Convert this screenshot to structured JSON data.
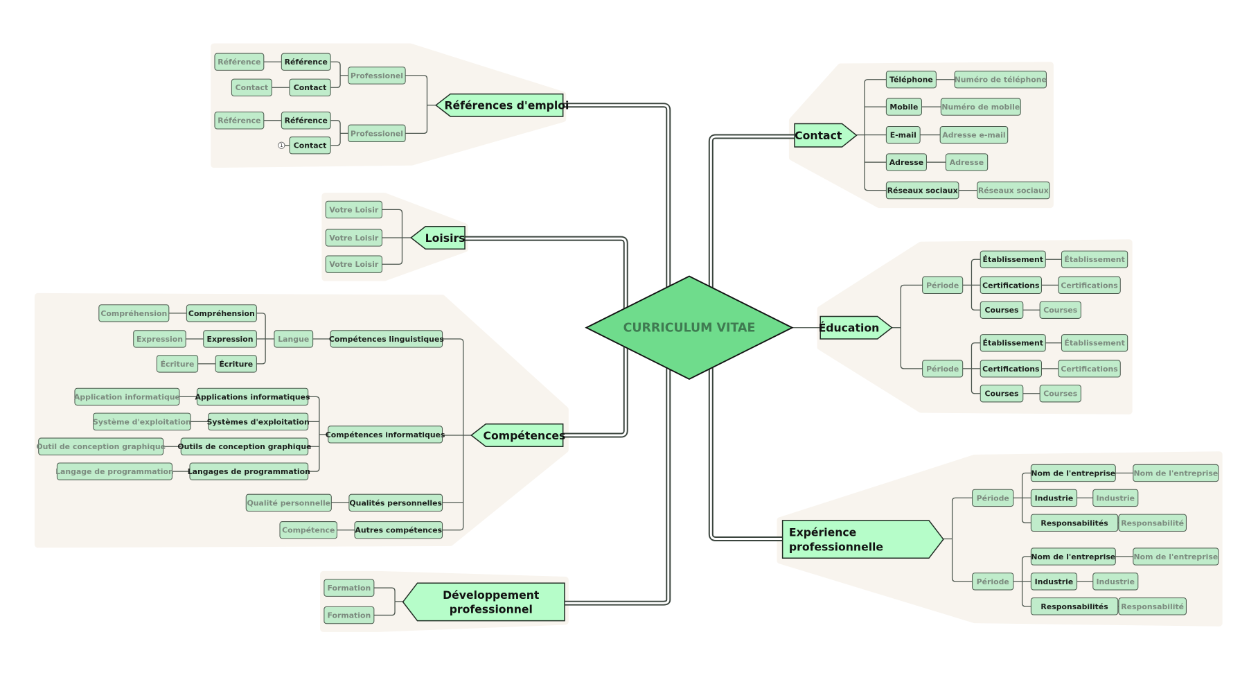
{
  "title": "CURRICULUM VITAE",
  "colors": {
    "center_fill": "#6fdc8c",
    "main_fill": "#b6fdc9",
    "leaf_fill": "#c0eccb",
    "group_bg": "#f8f4ee",
    "connector": "#3a443d"
  },
  "branches": {
    "references": {
      "label": "Références d'emploi",
      "groups": [
        {
          "label": "Professionel",
          "items": [
            {
              "label": "Référence",
              "value": "Référence"
            },
            {
              "label": "Contact",
              "value": "Contact"
            }
          ]
        },
        {
          "label": "Professionel",
          "items": [
            {
              "label": "Référence",
              "value": "Référence"
            },
            {
              "label": "Contact",
              "value": null,
              "badge": "1"
            }
          ]
        }
      ]
    },
    "loisirs": {
      "label": "Loisirs",
      "items": [
        "Votre Loisir",
        "Votre Loisir",
        "Votre Loisir"
      ]
    },
    "competences": {
      "label": "Compétences",
      "linguistiques": {
        "label": "Compétences linguistiques",
        "sub": "Langue",
        "items": [
          {
            "label": "Compréhension",
            "value": "Compréhension"
          },
          {
            "label": "Expression",
            "value": "Expression"
          },
          {
            "label": "Écriture",
            "value": "Écriture"
          }
        ]
      },
      "informatiques": {
        "label": "Compétences informatiques",
        "items": [
          {
            "label": "Applications informatiques",
            "value": "Application informatique"
          },
          {
            "label": "Systèmes d'exploitation",
            "value": "Système d'exploitation"
          },
          {
            "label": "Outils de conception graphique",
            "value": "Outil de conception graphique"
          },
          {
            "label": "Langages de programmation",
            "value": "Langage de programmation"
          }
        ]
      },
      "qualites": {
        "label": "Qualités personnelles",
        "value": "Qualité personnelle"
      },
      "autres": {
        "label": "Autres compétences",
        "value": "Compétence"
      }
    },
    "developpement": {
      "label_line1": "Développement",
      "label_line2": "professionnel",
      "items": [
        "Formation",
        "Formation"
      ]
    },
    "contact": {
      "label": "Contact",
      "items": [
        {
          "label": "Téléphone",
          "value": "Numéro de téléphone"
        },
        {
          "label": "Mobile",
          "value": "Numéro de mobile"
        },
        {
          "label": "E-mail",
          "value": "Adresse e-mail"
        },
        {
          "label": "Adresse",
          "value": "Adresse"
        },
        {
          "label": "Réseaux sociaux",
          "value": "Réseaux sociaux"
        }
      ]
    },
    "education": {
      "label": "Éducation",
      "periods": [
        {
          "label": "Période",
          "items": [
            {
              "label": "Établissement",
              "value": "Établissement"
            },
            {
              "label": "Certifications",
              "value": "Certifications"
            },
            {
              "label": "Courses",
              "value": "Courses"
            }
          ]
        },
        {
          "label": "Période",
          "items": [
            {
              "label": "Établissement",
              "value": "Établissement"
            },
            {
              "label": "Certifications",
              "value": "Certifications"
            },
            {
              "label": "Courses",
              "value": "Courses"
            }
          ]
        }
      ]
    },
    "experience": {
      "label_line1": "Expérience",
      "label_line2": "professionnelle",
      "periods": [
        {
          "label": "Période",
          "items": [
            {
              "label": "Nom de l'entreprise",
              "value": "Nom de l'entreprise"
            },
            {
              "label": "Industrie",
              "value": "Industrie"
            },
            {
              "label": "Responsabilités",
              "value": "Responsabilité"
            }
          ]
        },
        {
          "label": "Période",
          "items": [
            {
              "label": "Nom de l'entreprise",
              "value": "Nom de l'entreprise"
            },
            {
              "label": "Industrie",
              "value": "Industrie"
            },
            {
              "label": "Responsabilités",
              "value": "Responsabilité"
            }
          ]
        }
      ]
    }
  }
}
